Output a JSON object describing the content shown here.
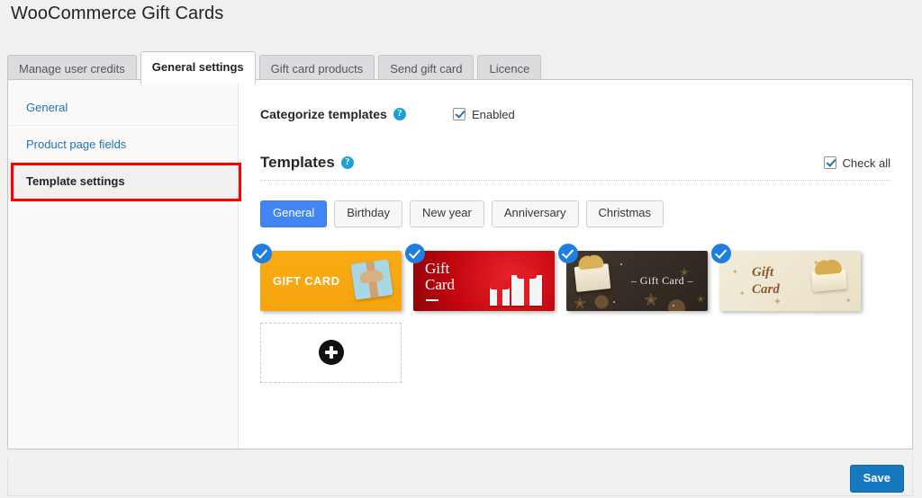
{
  "page": {
    "title": "WooCommerce Gift Cards"
  },
  "tabs": [
    {
      "label": "Manage user credits",
      "active": false
    },
    {
      "label": "General settings",
      "active": true
    },
    {
      "label": "Gift card products",
      "active": false
    },
    {
      "label": "Send gift card",
      "active": false
    },
    {
      "label": "Licence",
      "active": false
    }
  ],
  "sidebar": {
    "items": [
      {
        "label": "General",
        "active": false
      },
      {
        "label": "Product page fields",
        "active": false
      },
      {
        "label": "Template settings",
        "active": true
      }
    ]
  },
  "annotation": {
    "color": "#ff0000",
    "target": "Template settings"
  },
  "settings": {
    "categorize": {
      "label": "Categorize templates",
      "help_icon": "help-circle-icon",
      "checkbox_label": "Enabled",
      "checked": true
    },
    "templates": {
      "title": "Templates",
      "help_icon": "help-circle-icon",
      "check_all_label": "Check all",
      "check_all_checked": true,
      "categories": [
        {
          "label": "General",
          "active": true
        },
        {
          "label": "Birthday",
          "active": false
        },
        {
          "label": "New year",
          "active": false
        },
        {
          "label": "Anniversary",
          "active": false
        },
        {
          "label": "Christmas",
          "active": false
        }
      ],
      "cards": [
        {
          "name": "orange-gift-card",
          "text": "GIFT CARD",
          "selected": true,
          "bg_color": "#f7a60f"
        },
        {
          "name": "red-gift-card",
          "line1": "Gift",
          "line2": "Card",
          "selected": true,
          "bg_color": "#c4070f"
        },
        {
          "name": "dark-gift-card",
          "text": "– Gift Card –",
          "selected": true,
          "bg_color": "#332b24"
        },
        {
          "name": "cream-gift-card",
          "line1": "Gift",
          "line2": "Card",
          "selected": true,
          "bg_color": "#ece3cb"
        }
      ],
      "add_tile": {
        "icon": "plus-circle-icon"
      }
    }
  },
  "footer": {
    "save_label": "Save",
    "save_color": "#1678be"
  }
}
